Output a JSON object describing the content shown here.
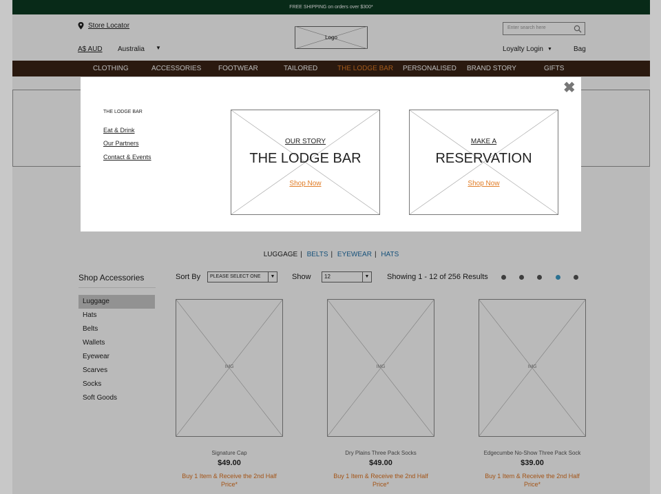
{
  "promo_bar": {
    "text": "FREE SHIPPING on orders over $300*"
  },
  "header": {
    "store_locator": "Store Locator",
    "currency": "A$ AUD",
    "country": "Australia",
    "logo": "Logo",
    "search_placeholder": "Enter search here",
    "loyalty_login": "Loyalty Login",
    "bag": "Bag"
  },
  "nav": {
    "items": [
      "CLOTHING",
      "ACCESSORIES",
      "FOOTWEAR",
      "TAILORED",
      "THE LODGE BAR",
      "PERSONALISED",
      "BRAND STORY",
      "GIFTS"
    ],
    "active_index": 4
  },
  "category_filters": {
    "current": "LUGGAGE",
    "links": [
      "BELTS",
      "EYEWEAR",
      "HATS"
    ]
  },
  "sidebar": {
    "title": "Shop Accessories",
    "items": [
      "Luggage",
      "Hats",
      "Belts",
      "Wallets",
      "Eyewear",
      "Scarves",
      "Socks",
      "Soft Goods"
    ],
    "selected_index": 0
  },
  "toolbar": {
    "sort_by_label": "Sort By",
    "sort_value": "PLEASE SELECT ONE",
    "show_label": "Show",
    "show_value": "12",
    "results": "Showing 1 - 12 of 256 Results",
    "pagination_active": 3
  },
  "products": [
    {
      "name": "Signature Cap",
      "price": "$49.00",
      "promo": "Buy 1 Item & Receive the 2nd Half Price*",
      "img_label": "IMG"
    },
    {
      "name": "Dry Plains Three Pack Socks",
      "price": "$49.00",
      "promo": "Buy 1 Item & Receive the 2nd Half Price*",
      "img_label": "IMG"
    },
    {
      "name": "Edgecumbe No-Show Three Pack Sock",
      "price": "$39.00",
      "promo": "Buy 1 Item & Receive the 2nd Half Price*",
      "img_label": "IMG"
    }
  ],
  "modal": {
    "close": "✖",
    "heading": "THE LODGE BAR",
    "links": [
      "Eat & Drink",
      "Our Partners",
      "Contact & Events"
    ],
    "cards": [
      {
        "subtitle": "OUR STORY",
        "title": "THE LODGE BAR",
        "cta": "Shop Now"
      },
      {
        "subtitle": "MAKE A",
        "title": "RESERVATION",
        "cta": "Shop Now"
      }
    ]
  },
  "colors": {
    "promo_bar": "#0b3a22",
    "nav_bar": "#3a2315",
    "accent": "#e07b24",
    "link_blue": "#1f6fa8"
  }
}
